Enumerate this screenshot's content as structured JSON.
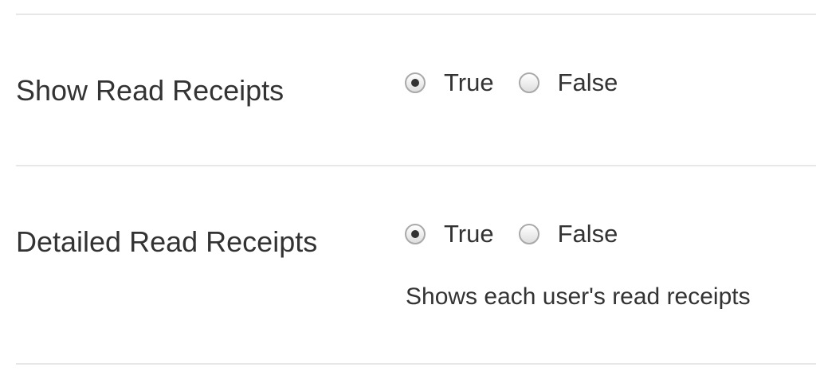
{
  "settings": [
    {
      "label": "Show Read Receipts",
      "options": [
        {
          "label": "True",
          "checked": true
        },
        {
          "label": "False",
          "checked": false
        }
      ],
      "help": ""
    },
    {
      "label": "Detailed Read Receipts",
      "options": [
        {
          "label": "True",
          "checked": true
        },
        {
          "label": "False",
          "checked": false
        }
      ],
      "help": "Shows each user's read receipts"
    }
  ],
  "colors": {
    "text": "#333333",
    "divider": "#e7e7e7",
    "radio_border": "#a9a9a9",
    "radio_dot": "#333333"
  }
}
